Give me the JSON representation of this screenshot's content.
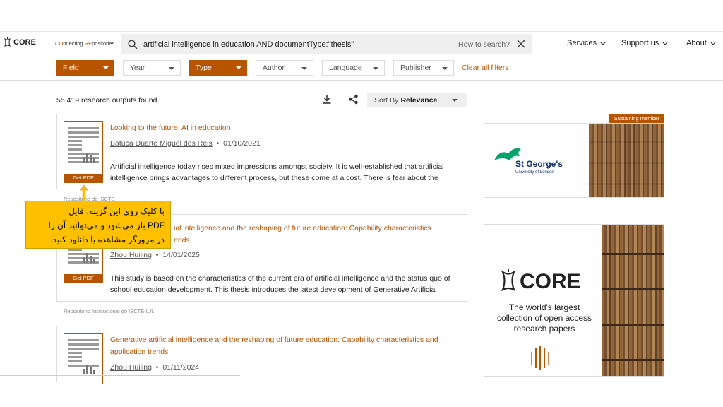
{
  "header": {
    "logo_text": "CORE",
    "tagline_1": "CO",
    "tagline_2": "nnecting ",
    "tagline_3": "RE",
    "tagline_4": "positories",
    "search_query": "artificial intelligence in education AND documentType:\"thesis\"",
    "how_to_search": "How to search?",
    "nav": [
      {
        "label": "Services"
      },
      {
        "label": "Support us"
      },
      {
        "label": "About"
      }
    ]
  },
  "filters": {
    "items": [
      {
        "label": "Field",
        "active": true
      },
      {
        "label": "Year",
        "active": false
      },
      {
        "label": "Type",
        "active": true
      },
      {
        "label": "Author",
        "active": false
      },
      {
        "label": "Language",
        "active": false
      },
      {
        "label": "Publisher",
        "active": false
      }
    ],
    "clear_label": "Clear all filters"
  },
  "results": {
    "count_text": "55,419 research outputs found",
    "sort_prefix": "Sort By",
    "sort_value": "Relevance",
    "items": [
      {
        "title": "Looking to the future: AI in education",
        "author": "Batuca Duarte Miguel dos Reis",
        "date": "01/10/2021",
        "abstract": "Artificial intelligence today rises mixed impressions amongst society. It is well-established that artificial intelligence brings advantages to different process, but these come at a cost. There is fear about the",
        "pdf_label": "Get PDF",
        "repository": "Repositório do ISCTE"
      },
      {
        "title": "ial intelligence and the reshaping of future education: Capability characteristics",
        "title_2": "ends",
        "author": "Zhou Huiling",
        "date": "14/01/2025",
        "abstract": "This study is based on the characteristics of the current era of artificial intelligence and the status quo of school education development. This thesis introduces the latest development of Generative Artificial",
        "pdf_label": "Get PDF",
        "repository": "Repositório Institucional do ISCTE-IUL"
      },
      {
        "title": "Generative artificial intelligence and the reshaping of future education: Capability characteristics and application trends",
        "author": "Zhou Huiling",
        "date": "01/11/2024"
      }
    ]
  },
  "sidebar": {
    "badge": "Sustaining member",
    "ad1_name": "St George's",
    "ad1_sub": "University of London",
    "ad2_logo": "CORE",
    "ad2_text": "The world's largest collection of open access research papers"
  },
  "annotation": {
    "line1": "با کلیک روی این گزینه، فایل",
    "line2": "PDF باز می‌شود و می‌توانید آن را",
    "line3": "در مرورگر مشاهده یا دانلود کنید."
  },
  "colors": {
    "accent": "#b75400",
    "callout": "#ffc000"
  }
}
